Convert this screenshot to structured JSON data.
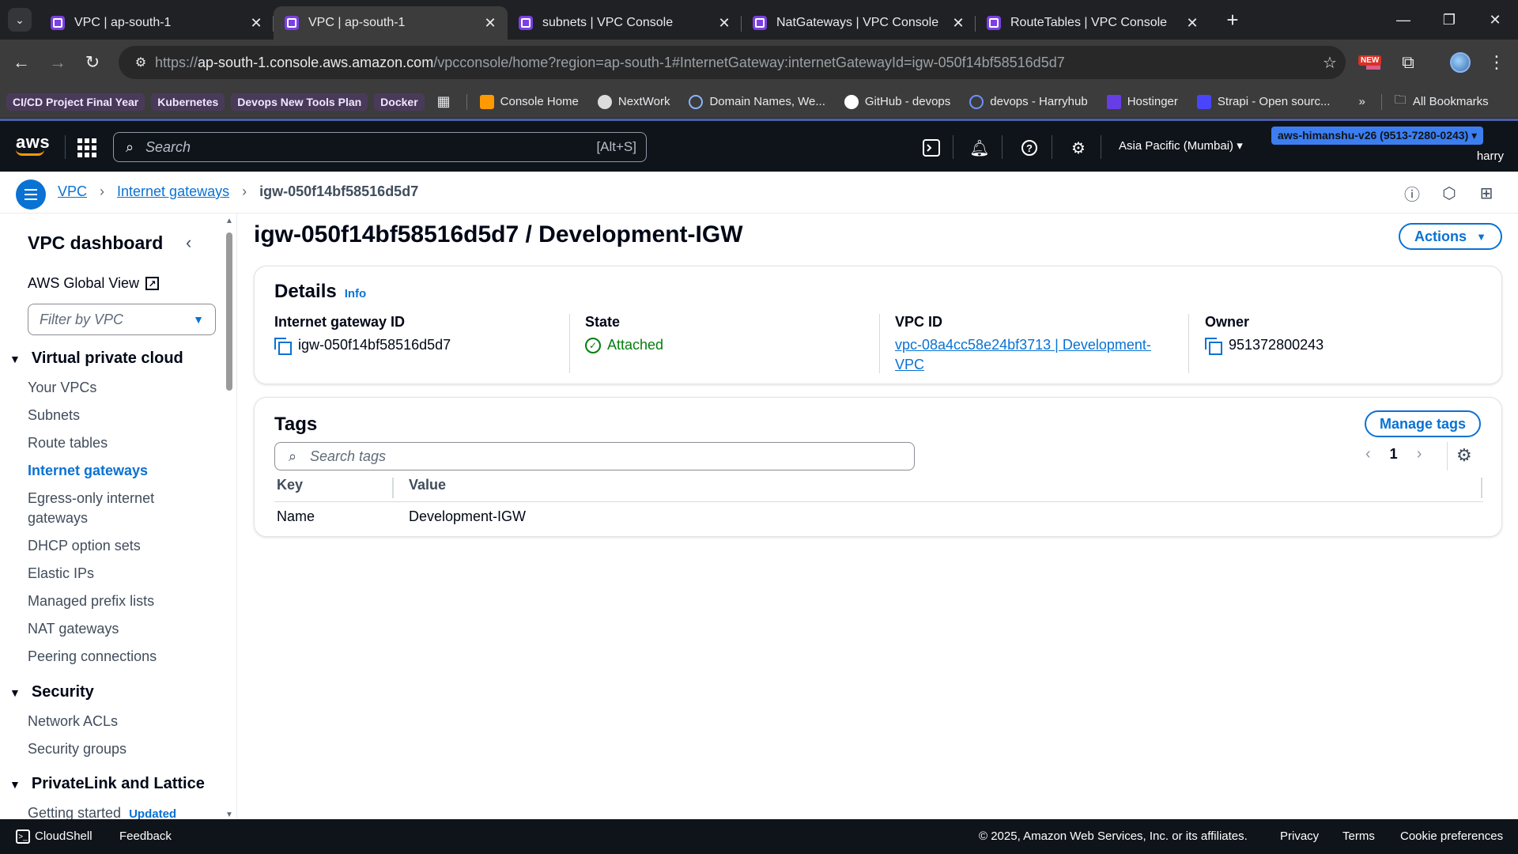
{
  "browser": {
    "tabs": [
      {
        "title": "VPC | ap-south-1",
        "active": false
      },
      {
        "title": "VPC | ap-south-1",
        "active": true
      },
      {
        "title": "subnets | VPC Console",
        "active": false
      },
      {
        "title": "NatGateways | VPC Console",
        "active": false
      },
      {
        "title": "RouteTables | VPC Console",
        "active": false
      }
    ],
    "url_scheme": "https://",
    "url_host": "ap-south-1.console.aws.amazon.com",
    "url_path": "/vpcconsole/home?region=ap-south-1#InternetGateway:internetGatewayId=igw-050f14bf58516d5d7",
    "new_badge": "NEW",
    "bookmarks": {
      "cicd": "CI/CD Project Final Year",
      "kubernetes": "Kubernetes",
      "devops_tools": "Devops New Tools Plan",
      "docker": "Docker",
      "console_home": "Console Home",
      "nextwork": "NextWork",
      "domain_names": "Domain Names, We...",
      "github": "GitHub - devops",
      "harryhub": "devops - Harryhub",
      "hostinger": "Hostinger",
      "strapi": "Strapi - Open sourc...",
      "all_bookmarks": "All Bookmarks"
    }
  },
  "aws_nav": {
    "logo": "aws",
    "search_placeholder": "Search",
    "search_shortcut": "[Alt+S]",
    "region": "Asia Pacific (Mumbai)",
    "account": "aws-himanshu-v26 (9513-7280-0243)",
    "username": "harry"
  },
  "breadcrumb": {
    "vpc": "VPC",
    "internet_gateways": "Internet gateways",
    "current": "igw-050f14bf58516d5d7"
  },
  "sidebar": {
    "title": "VPC dashboard",
    "global_view": "AWS Global View",
    "filter_placeholder": "Filter by VPC",
    "section_vpc": "Virtual private cloud",
    "items_vpc": {
      "your_vpcs": "Your VPCs",
      "subnets": "Subnets",
      "route_tables": "Route tables",
      "internet_gateways": "Internet gateways",
      "egress_only_1": "Egress-only internet",
      "egress_only_2": "gateways",
      "dhcp": "DHCP option sets",
      "elastic_ips": "Elastic IPs",
      "prefix_lists": "Managed prefix lists",
      "nat_gateways": "NAT gateways",
      "peering": "Peering connections"
    },
    "section_security": "Security",
    "items_security": {
      "nacls": "Network ACLs",
      "security_groups": "Security groups"
    },
    "section_privatelink": "PrivateLink and Lattice",
    "getting_started": "Getting started",
    "updated_badge": "Updated"
  },
  "main": {
    "title": "igw-050f14bf58516d5d7 / Development-IGW",
    "actions_label": "Actions",
    "details": {
      "title": "Details",
      "info": "Info",
      "igw_label": "Internet gateway ID",
      "igw_value": "igw-050f14bf58516d5d7",
      "state_label": "State",
      "state_value": "Attached",
      "vpc_label": "VPC ID",
      "vpc_value_1": "vpc-08a4cc58e24bf3713 | Development-",
      "vpc_value_2": "VPC",
      "owner_label": "Owner",
      "owner_value": "951372800243"
    },
    "tags": {
      "title": "Tags",
      "manage_label": "Manage tags",
      "search_placeholder": "Search tags",
      "page": "1",
      "col_key": "Key",
      "col_value": "Value",
      "rows": [
        {
          "key": "Name",
          "value": "Development-IGW"
        }
      ]
    }
  },
  "footer": {
    "cloudshell": "CloudShell",
    "feedback": "Feedback",
    "copyright": "© 2025, Amazon Web Services, Inc. or its affiliates.",
    "privacy": "Privacy",
    "terms": "Terms",
    "cookie": "Cookie preferences"
  },
  "colors": {
    "link_blue": "#0972d3",
    "success_green": "#037f0c",
    "nav_dark": "#0f141a",
    "chrome_dark": "#202124"
  }
}
